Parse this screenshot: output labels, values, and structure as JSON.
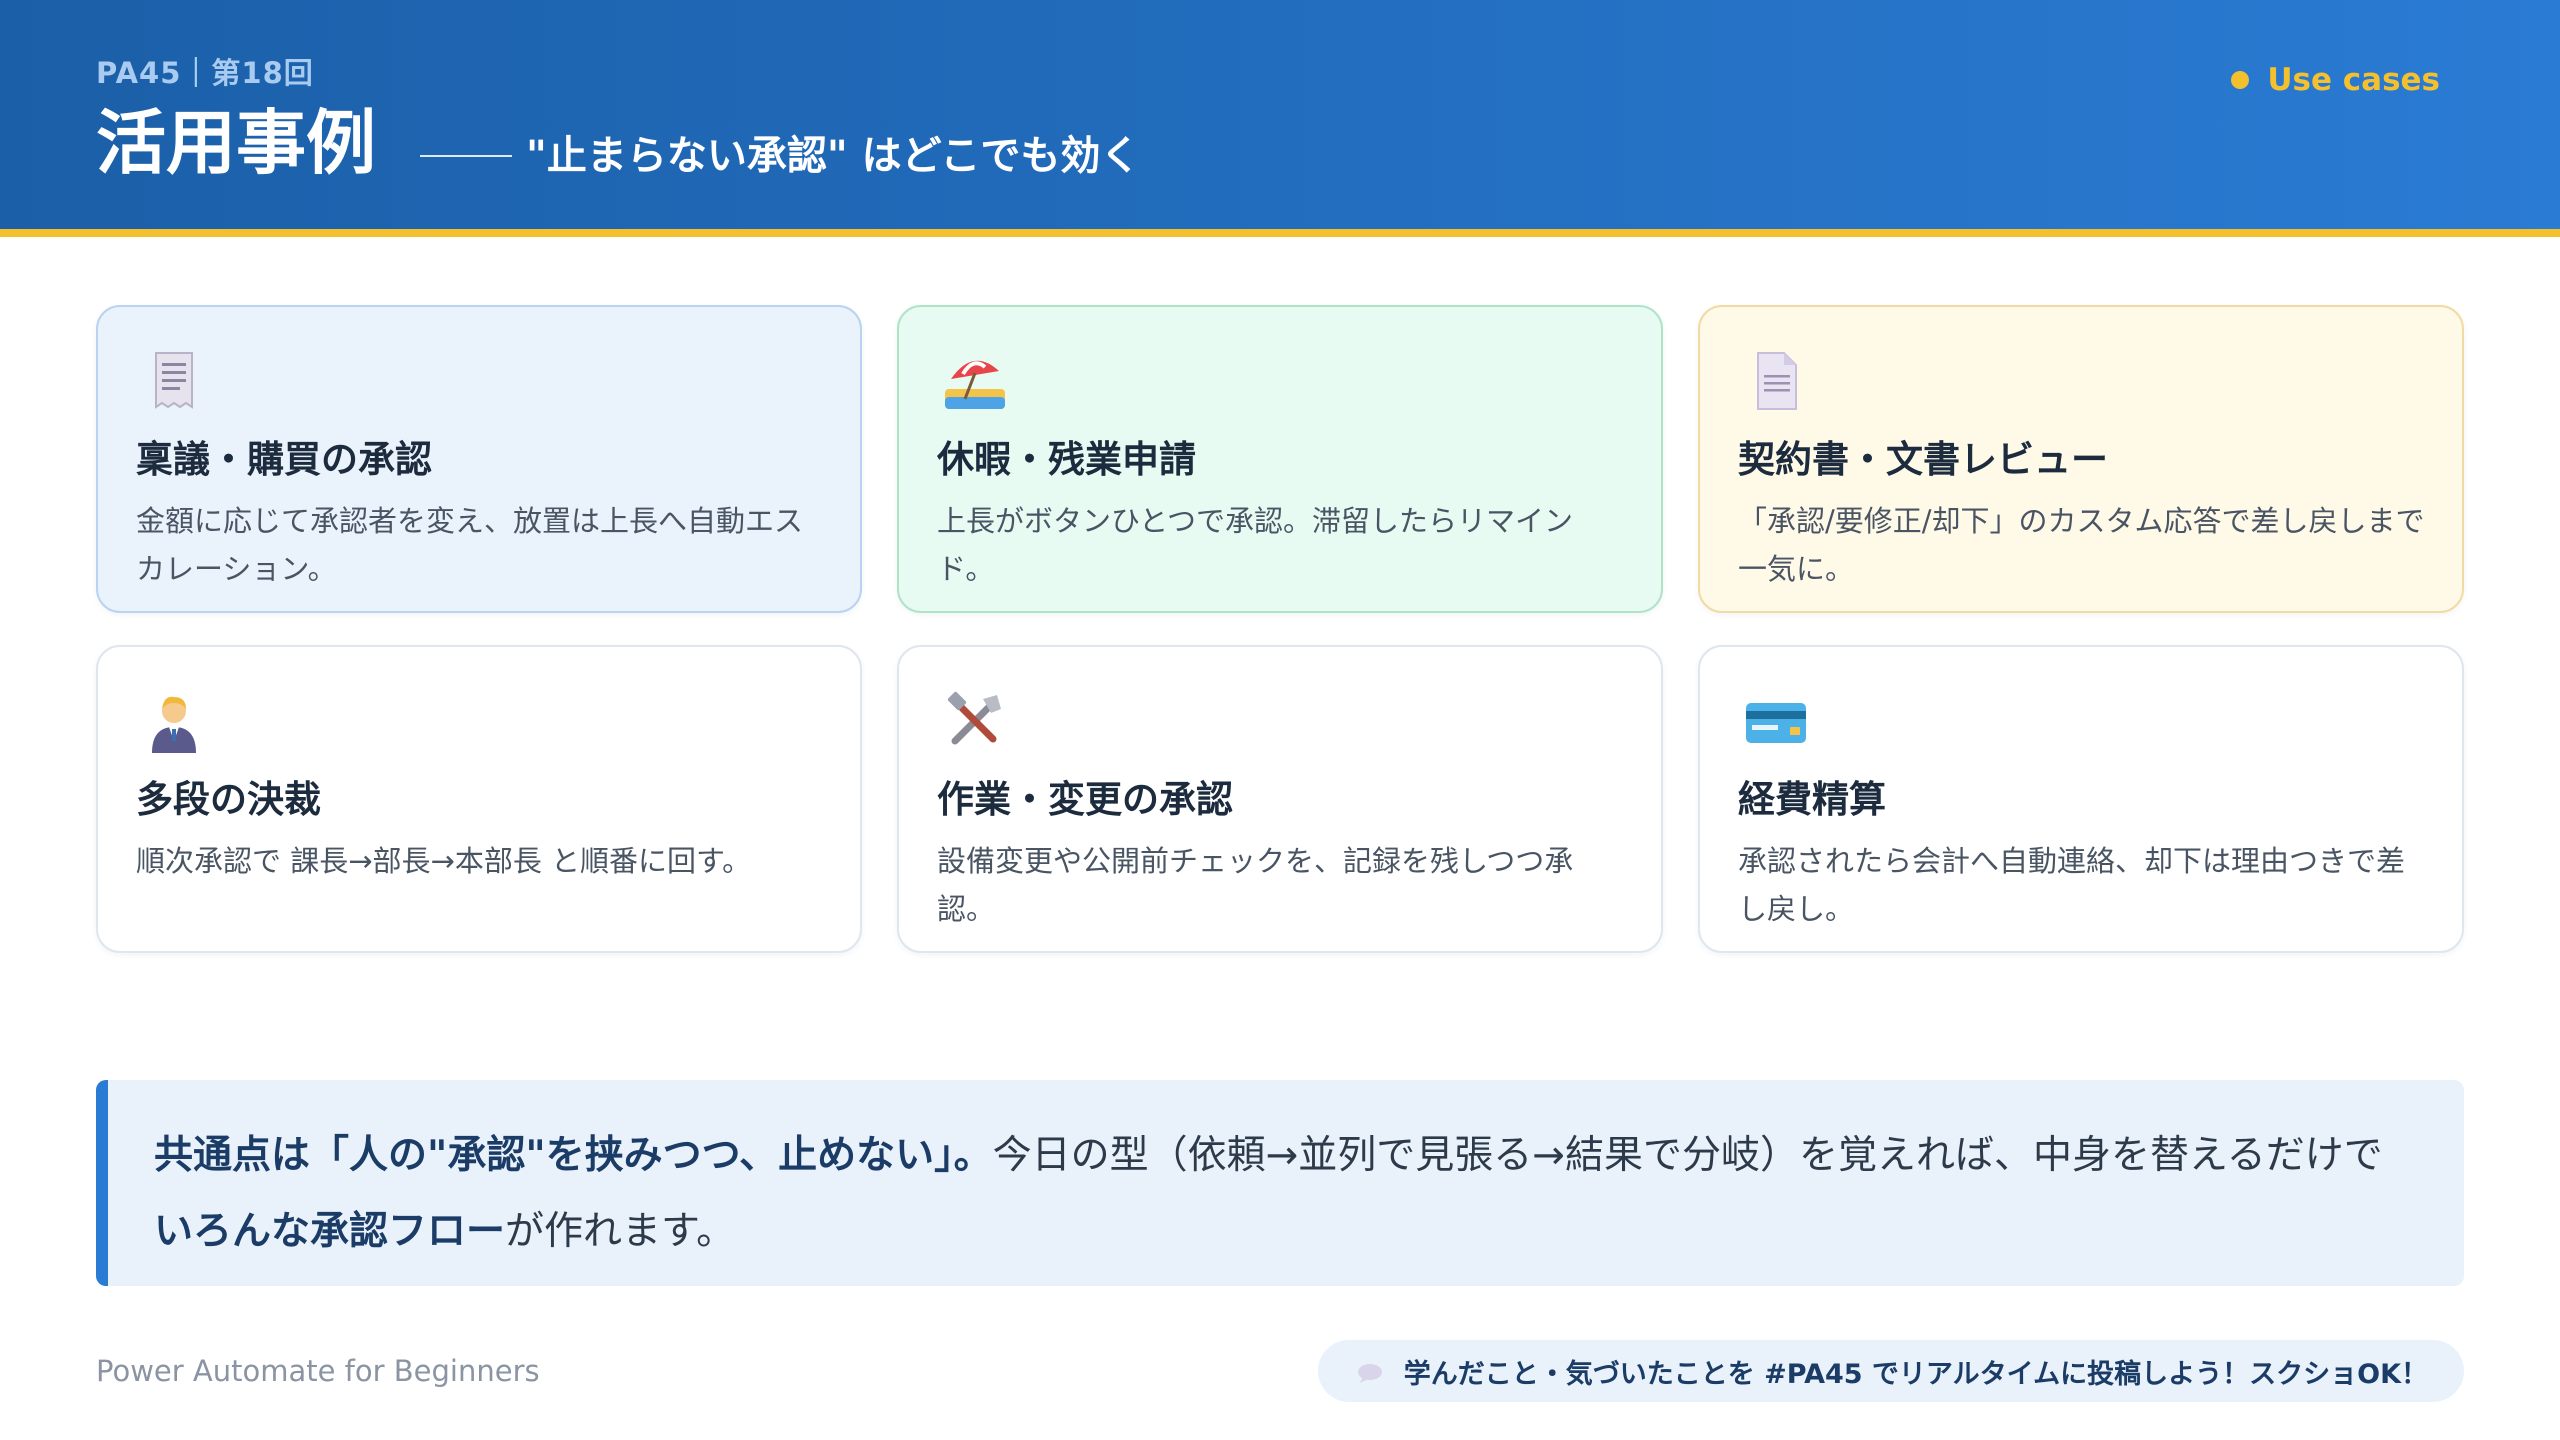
{
  "header": {
    "series": "PA45｜第18回",
    "title": "活用事例",
    "subtitle": "\"止まらない承認\" はどこでも効く",
    "tag": "Use cases"
  },
  "colors": {
    "header_start": "#1b5fa8",
    "header_end": "#2a7bd4",
    "accent_yellow": "#f5c02e",
    "callout_bar": "#2a7bd4"
  },
  "cards": [
    {
      "icon": "receipt-icon",
      "title": "稟議・購買の承認",
      "desc": "金額に応じて承認者を変え、放置は上長へ自動エスカレーション。"
    },
    {
      "icon": "beach-umbrella-icon",
      "title": "休暇・残業申請",
      "desc": "上長がボタンひとつで承認。滞留したらリマインド。"
    },
    {
      "icon": "document-icon",
      "title": "契約書・文書レビュー",
      "desc": "「承認/要修正/却下」のカスタム応答で差し戻しまで一気に。"
    },
    {
      "icon": "manager-icon",
      "title": "多段の決裁",
      "desc": "順次承認で 課長→部長→本部長 と順番に回す。"
    },
    {
      "icon": "tools-icon",
      "title": "作業・変更の承認",
      "desc": "設備変更や公開前チェックを、記録を残しつつ承認。"
    },
    {
      "icon": "credit-card-icon",
      "title": "経費精算",
      "desc": "承認されたら会計へ自動連絡、却下は理由つきで差し戻し。"
    }
  ],
  "callout": {
    "bold1": "共通点は「人の\"承認\"を挟みつつ、止めない」。",
    "text1": "今日の型（依頼→並列で見張る→結果で分岐）を覚えれば、中身を替えるだけで ",
    "bold2": "いろんな承認フロー",
    "text2": "が作れます。"
  },
  "footer": {
    "left": "Power Automate for Beginners",
    "pill": "学んだこと・気づいたことを #PA45 でリアルタイムに投稿しよう！スクショOK！"
  }
}
